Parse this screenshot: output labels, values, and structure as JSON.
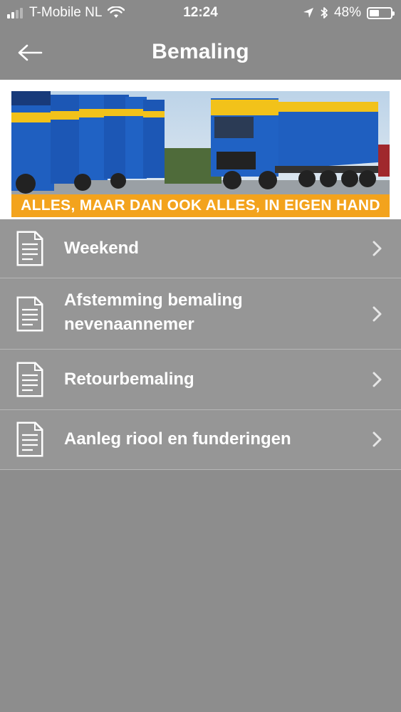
{
  "status_bar": {
    "carrier": "T-Mobile NL",
    "time": "12:24",
    "battery": "48%",
    "battery_level": 0.48,
    "icons": [
      "signal-icon",
      "wifi-icon",
      "location-icon",
      "bluetooth-icon",
      "battery-icon"
    ]
  },
  "nav": {
    "title": "Bemaling",
    "back_icon": "back-arrow-icon"
  },
  "banner": {
    "caption": "ALLES, MAAR DAN OOK ALLES, IN EIGEN HAND",
    "colors": {
      "truck_blue": "#1f5fc0",
      "truck_yellow": "#f2c21a",
      "caption_orange": "#f3a31d"
    }
  },
  "list": {
    "items": [
      {
        "label": "Weekend",
        "icon": "document-icon"
      },
      {
        "label": "Afstemming bemaling nevenaannemer",
        "line1": "Afstemming bemaling",
        "line2": "nevenaannemer",
        "icon": "document-icon"
      },
      {
        "label": "Retourbemaling",
        "icon": "document-icon"
      },
      {
        "label": "Aanleg riool en funderingen",
        "icon": "document-icon"
      }
    ]
  }
}
